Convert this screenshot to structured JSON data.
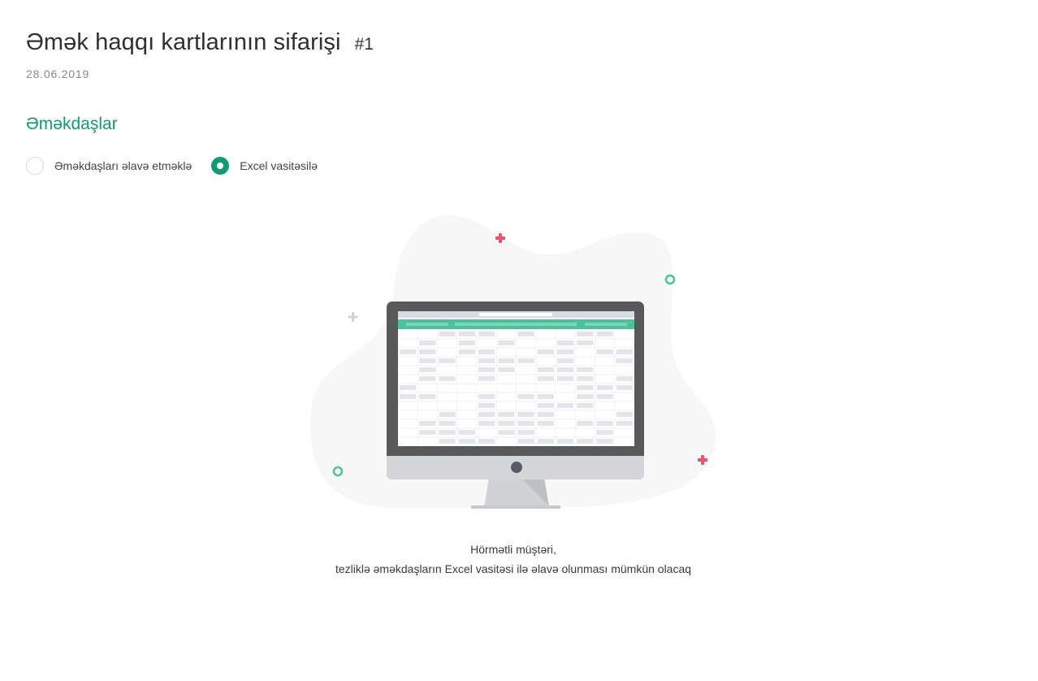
{
  "header": {
    "title": "Əmək haqqı kartlarının sifarişi",
    "order_number": "#1",
    "date": "28.06.2019"
  },
  "employees_section": {
    "title": "Əməkdaşlar",
    "options": [
      {
        "label": "Əməkdaşları əlavə etməklə",
        "selected": false
      },
      {
        "label": "Excel vasitəsilə",
        "selected": true
      }
    ]
  },
  "illustration": {
    "icon": "monitor-spreadsheet-illustration",
    "accent_color": "#4bc29b",
    "decor_red": "#e8546b"
  },
  "message": {
    "line1": "Hörmətli müştəri,",
    "line2": "tezliklə əməkdaşların Excel vasitəsi ilə əlavə olunması mümkün olacaq"
  },
  "colors": {
    "primary": "#0f9b74",
    "text": "#2f2f2f",
    "muted": "#8a8a8a"
  }
}
